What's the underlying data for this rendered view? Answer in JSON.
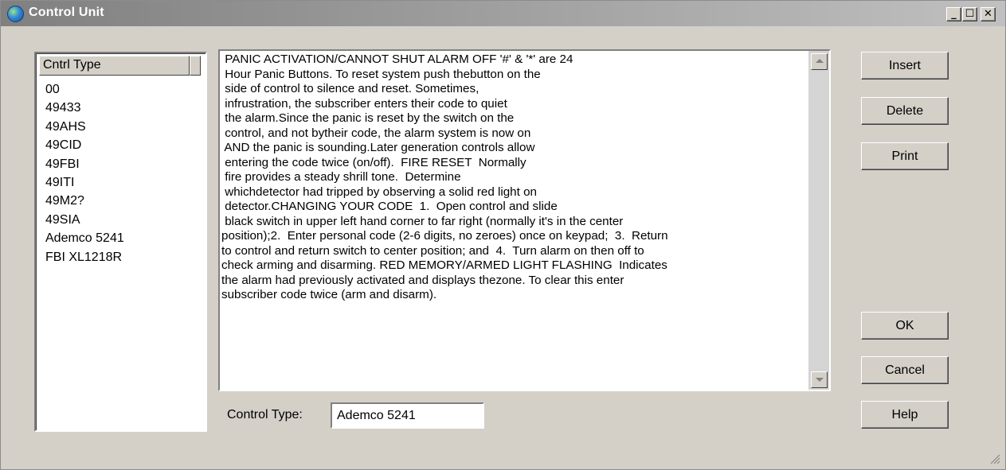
{
  "window": {
    "title": "Control Unit",
    "app_icon": "globe-icon",
    "minimize_glyph": "_",
    "maximize_glyph": "☐",
    "close_glyph": "✕"
  },
  "list": {
    "header": "Cntrl Type",
    "items": [
      {
        "label": "00"
      },
      {
        "label": "49433"
      },
      {
        "label": "49AHS"
      },
      {
        "label": "49CID"
      },
      {
        "label": "49FBI"
      },
      {
        "label": "49ITI"
      },
      {
        "label": "49M2?"
      },
      {
        "label": "49SIA"
      },
      {
        "label": "Ademco 5241"
      },
      {
        "label": "FBI XL1218R"
      }
    ]
  },
  "notes": {
    "text": " PANIC ACTIVATION/CANNOT SHUT ALARM OFF '#' & '*' are 24\n Hour Panic Buttons. To reset system push thebutton on the\n side of control to silence and reset. Sometimes,\n infrustration, the subscriber enters their code to quiet\n the alarm.Since the panic is reset by the switch on the\n control, and not bytheir code, the alarm system is now on\n AND the panic is sounding.Later generation controls allow\n entering the code twice (on/off).  FIRE RESET  Normally\n fire provides a steady shrill tone.  Determine\n whichdetector had tripped by observing a solid red light on\n detector.CHANGING YOUR CODE  1.  Open control and slide\n black switch in upper left hand corner to far right (normally it's in the center\nposition);2.  Enter personal code (2-6 digits, no zeroes) once on keypad;  3.  Return\nto control and return switch to center position; and  4.  Turn alarm on then off to\ncheck arming and disarming. RED MEMORY/ARMED LIGHT FLASHING  Indicates\nthe alarm had previously activated and displays thezone. To clear this enter\nsubscriber code twice (arm and disarm)."
  },
  "control_type": {
    "label": "Control Type:",
    "value": "Ademco 5241"
  },
  "buttons": {
    "insert": "Insert",
    "delete": "Delete",
    "print": "Print",
    "ok": "OK",
    "cancel": "Cancel",
    "help": "Help"
  },
  "colors": {
    "dialog_bg": "#d4d0c8",
    "titlebar_inactive": "#808080",
    "field_bg": "#ffffff"
  }
}
